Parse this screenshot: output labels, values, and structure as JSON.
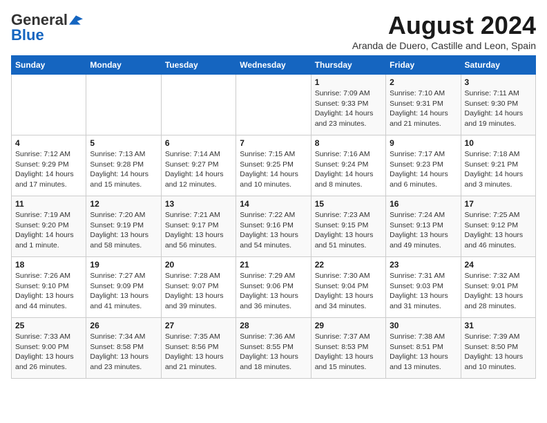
{
  "logo": {
    "general": "General",
    "blue": "Blue"
  },
  "title": "August 2024",
  "location": "Aranda de Duero, Castille and Leon, Spain",
  "days_of_week": [
    "Sunday",
    "Monday",
    "Tuesday",
    "Wednesday",
    "Thursday",
    "Friday",
    "Saturday"
  ],
  "weeks": [
    [
      {
        "day": "",
        "detail": ""
      },
      {
        "day": "",
        "detail": ""
      },
      {
        "day": "",
        "detail": ""
      },
      {
        "day": "",
        "detail": ""
      },
      {
        "day": "1",
        "detail": "Sunrise: 7:09 AM\nSunset: 9:33 PM\nDaylight: 14 hours and 23 minutes."
      },
      {
        "day": "2",
        "detail": "Sunrise: 7:10 AM\nSunset: 9:31 PM\nDaylight: 14 hours and 21 minutes."
      },
      {
        "day": "3",
        "detail": "Sunrise: 7:11 AM\nSunset: 9:30 PM\nDaylight: 14 hours and 19 minutes."
      }
    ],
    [
      {
        "day": "4",
        "detail": "Sunrise: 7:12 AM\nSunset: 9:29 PM\nDaylight: 14 hours and 17 minutes."
      },
      {
        "day": "5",
        "detail": "Sunrise: 7:13 AM\nSunset: 9:28 PM\nDaylight: 14 hours and 15 minutes."
      },
      {
        "day": "6",
        "detail": "Sunrise: 7:14 AM\nSunset: 9:27 PM\nDaylight: 14 hours and 12 minutes."
      },
      {
        "day": "7",
        "detail": "Sunrise: 7:15 AM\nSunset: 9:25 PM\nDaylight: 14 hours and 10 minutes."
      },
      {
        "day": "8",
        "detail": "Sunrise: 7:16 AM\nSunset: 9:24 PM\nDaylight: 14 hours and 8 minutes."
      },
      {
        "day": "9",
        "detail": "Sunrise: 7:17 AM\nSunset: 9:23 PM\nDaylight: 14 hours and 6 minutes."
      },
      {
        "day": "10",
        "detail": "Sunrise: 7:18 AM\nSunset: 9:21 PM\nDaylight: 14 hours and 3 minutes."
      }
    ],
    [
      {
        "day": "11",
        "detail": "Sunrise: 7:19 AM\nSunset: 9:20 PM\nDaylight: 14 hours and 1 minute."
      },
      {
        "day": "12",
        "detail": "Sunrise: 7:20 AM\nSunset: 9:19 PM\nDaylight: 13 hours and 58 minutes."
      },
      {
        "day": "13",
        "detail": "Sunrise: 7:21 AM\nSunset: 9:17 PM\nDaylight: 13 hours and 56 minutes."
      },
      {
        "day": "14",
        "detail": "Sunrise: 7:22 AM\nSunset: 9:16 PM\nDaylight: 13 hours and 54 minutes."
      },
      {
        "day": "15",
        "detail": "Sunrise: 7:23 AM\nSunset: 9:15 PM\nDaylight: 13 hours and 51 minutes."
      },
      {
        "day": "16",
        "detail": "Sunrise: 7:24 AM\nSunset: 9:13 PM\nDaylight: 13 hours and 49 minutes."
      },
      {
        "day": "17",
        "detail": "Sunrise: 7:25 AM\nSunset: 9:12 PM\nDaylight: 13 hours and 46 minutes."
      }
    ],
    [
      {
        "day": "18",
        "detail": "Sunrise: 7:26 AM\nSunset: 9:10 PM\nDaylight: 13 hours and 44 minutes."
      },
      {
        "day": "19",
        "detail": "Sunrise: 7:27 AM\nSunset: 9:09 PM\nDaylight: 13 hours and 41 minutes."
      },
      {
        "day": "20",
        "detail": "Sunrise: 7:28 AM\nSunset: 9:07 PM\nDaylight: 13 hours and 39 minutes."
      },
      {
        "day": "21",
        "detail": "Sunrise: 7:29 AM\nSunset: 9:06 PM\nDaylight: 13 hours and 36 minutes."
      },
      {
        "day": "22",
        "detail": "Sunrise: 7:30 AM\nSunset: 9:04 PM\nDaylight: 13 hours and 34 minutes."
      },
      {
        "day": "23",
        "detail": "Sunrise: 7:31 AM\nSunset: 9:03 PM\nDaylight: 13 hours and 31 minutes."
      },
      {
        "day": "24",
        "detail": "Sunrise: 7:32 AM\nSunset: 9:01 PM\nDaylight: 13 hours and 28 minutes."
      }
    ],
    [
      {
        "day": "25",
        "detail": "Sunrise: 7:33 AM\nSunset: 9:00 PM\nDaylight: 13 hours and 26 minutes."
      },
      {
        "day": "26",
        "detail": "Sunrise: 7:34 AM\nSunset: 8:58 PM\nDaylight: 13 hours and 23 minutes."
      },
      {
        "day": "27",
        "detail": "Sunrise: 7:35 AM\nSunset: 8:56 PM\nDaylight: 13 hours and 21 minutes."
      },
      {
        "day": "28",
        "detail": "Sunrise: 7:36 AM\nSunset: 8:55 PM\nDaylight: 13 hours and 18 minutes."
      },
      {
        "day": "29",
        "detail": "Sunrise: 7:37 AM\nSunset: 8:53 PM\nDaylight: 13 hours and 15 minutes."
      },
      {
        "day": "30",
        "detail": "Sunrise: 7:38 AM\nSunset: 8:51 PM\nDaylight: 13 hours and 13 minutes."
      },
      {
        "day": "31",
        "detail": "Sunrise: 7:39 AM\nSunset: 8:50 PM\nDaylight: 13 hours and 10 minutes."
      }
    ]
  ]
}
